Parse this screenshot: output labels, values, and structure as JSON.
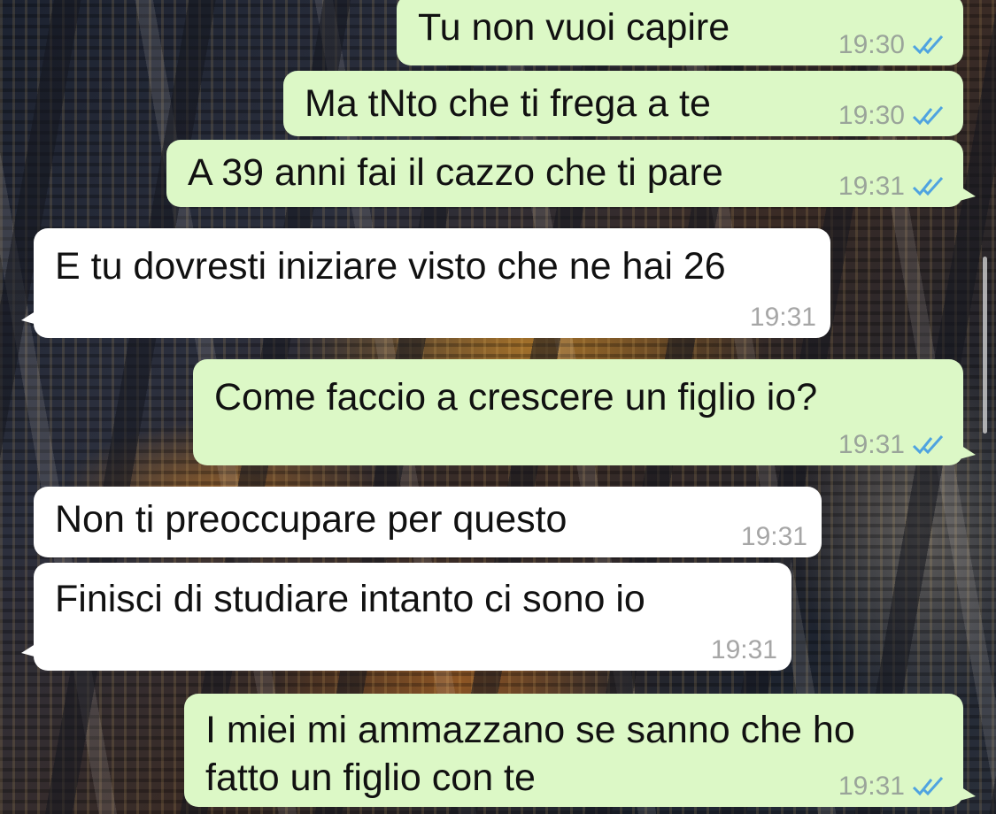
{
  "chat": {
    "messages": [
      {
        "text": "Tu non vuoi capire",
        "time": "19:30",
        "direction": "outgoing",
        "status": "read"
      },
      {
        "text": "Ma tNto che ti frega a te",
        "time": "19:30",
        "direction": "outgoing",
        "status": "read"
      },
      {
        "text": "A 39 anni fai il cazzo che ti pare",
        "time": "19:31",
        "direction": "outgoing",
        "status": "read"
      },
      {
        "text": "E tu dovresti iniziare visto che ne hai 26",
        "time": "19:31",
        "direction": "incoming"
      },
      {
        "text": "Come faccio a crescere un figlio io?",
        "time": "19:31",
        "direction": "outgoing",
        "status": "read"
      },
      {
        "text": "Non ti preoccupare per questo",
        "time": "19:31",
        "direction": "incoming"
      },
      {
        "text": "Finisci di studiare intanto ci sono io",
        "time": "19:31",
        "direction": "incoming"
      },
      {
        "text_line1": "I miei mi ammazzano se sanno che ho",
        "text_line2": "fatto un figlio con te",
        "time": "19:31",
        "direction": "outgoing",
        "status": "read"
      }
    ]
  },
  "colors": {
    "outgoing_bubble": "#dcf8c6",
    "incoming_bubble": "#ffffff",
    "read_ticks": "#4fa3e0"
  },
  "icons": {
    "read_receipt": "double-check-icon"
  }
}
